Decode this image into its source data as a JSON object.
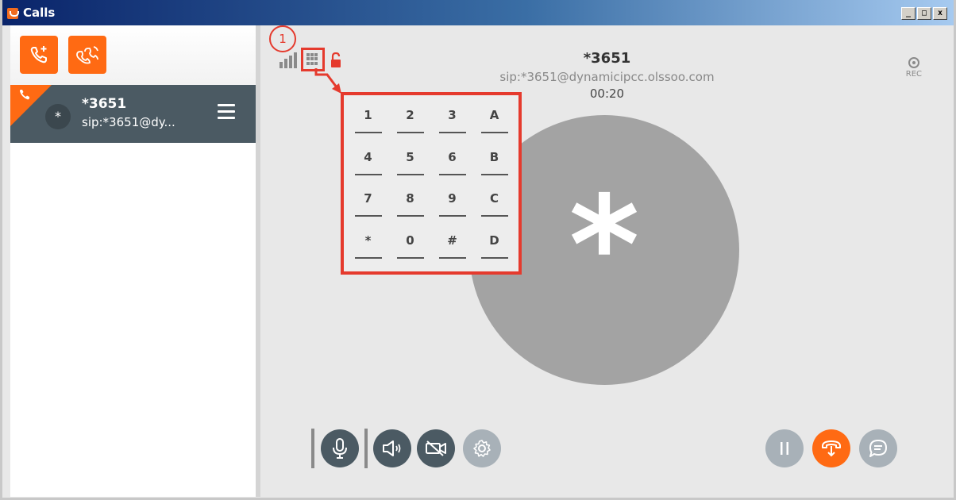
{
  "window": {
    "title": "Calls",
    "controls": {
      "minimize": "_",
      "maximize": "□",
      "close": "x"
    }
  },
  "sidebar": {
    "call_item": {
      "avatar_text": "*",
      "name": "*3651",
      "sip": "sip:*3651@dy..."
    }
  },
  "main": {
    "badge": "1",
    "call_name": "*3651",
    "call_sip": "sip:*3651@dynamicipcc.olssoo.com",
    "call_timer": "00:20",
    "rec_label": "REC",
    "avatar_symbol": "*",
    "dialpad_keys": [
      "1",
      "2",
      "3",
      "A",
      "4",
      "5",
      "6",
      "B",
      "7",
      "8",
      "9",
      "C",
      "*",
      "0",
      "#",
      "D"
    ]
  },
  "colors": {
    "accent": "#ff6a13",
    "highlight": "#e53a2d",
    "sidebar_item": "#4b5a63",
    "avatar": "#a3a3a3"
  },
  "icons": {
    "new_call": "phone-plus-icon",
    "conference": "conference-icon",
    "keypad": "keypad-icon",
    "lock": "unlocked-icon",
    "mic": "microphone-icon",
    "speaker": "speaker-icon",
    "video": "video-off-icon",
    "settings": "gear-icon",
    "hold": "pause-icon",
    "transfer": "transfer-icon",
    "chat": "chat-icon"
  }
}
